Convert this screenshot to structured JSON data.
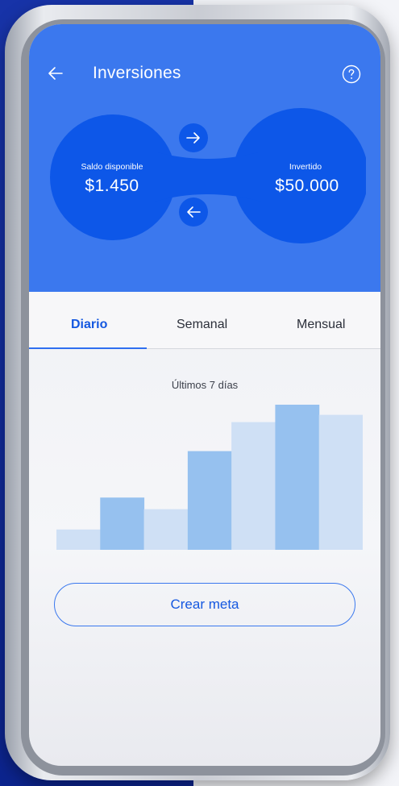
{
  "header": {
    "title": "Inversiones",
    "background_color": "#3b78ee",
    "back_icon": "arrow-left-icon",
    "help_icon": "question-circle-icon"
  },
  "balances": {
    "available": {
      "label": "Saldo disponible",
      "value": "$1.450"
    },
    "invested": {
      "label": "Invertido",
      "value": "$50.000"
    },
    "transfer_right_icon": "arrow-right-icon",
    "transfer_left_icon": "arrow-left-icon",
    "circle_color": "#0d57e8"
  },
  "tabs": [
    {
      "label": "Diario",
      "active": true
    },
    {
      "label": "Semanal",
      "active": false
    },
    {
      "label": "Mensual",
      "active": false
    }
  ],
  "chart": {
    "title": "Últimos 7 días"
  },
  "chart_data": {
    "type": "bar",
    "categories": [
      "",
      "",
      "",
      "",
      "",
      "",
      ""
    ],
    "values": [
      14,
      36,
      28,
      68,
      88,
      100,
      93
    ],
    "ylim": [
      0,
      100
    ],
    "grid": false,
    "bar_colors": [
      "#cfe0f5",
      "#96c1ef",
      "#cfe0f5",
      "#96c1ef",
      "#cfe0f5",
      "#96c1ef",
      "#cfe0f5"
    ]
  },
  "actions": {
    "create_goal_label": "Crear meta"
  }
}
